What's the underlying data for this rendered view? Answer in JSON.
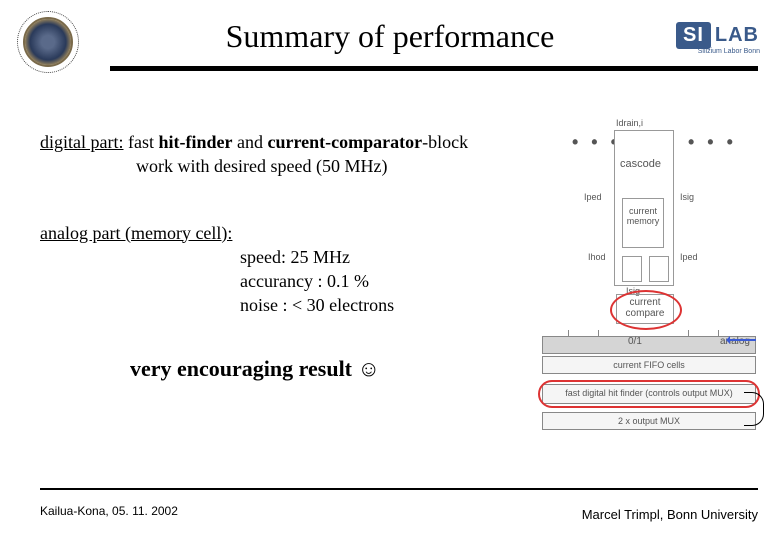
{
  "header": {
    "title": "Summary of performance",
    "logo_right_si": "SI",
    "logo_right_lab": "LAB",
    "logo_right_sub": "Silizium Labor Bonn"
  },
  "digital": {
    "label": "digital part:",
    "line1_a": "  fast ",
    "line1_b": "hit-finder",
    "line1_c": " and ",
    "line1_d": "current-comparator",
    "line1_e": "-block",
    "line2": "work with desired speed (50 MHz)"
  },
  "analog": {
    "label": "analog part (memory cell):",
    "spec1": "speed: 25 MHz",
    "spec2": "accurancy : 0.1 %",
    "spec3": "noise : < 30 electrons"
  },
  "encourage": {
    "text": "very encouraging result ",
    "emoji": "☺"
  },
  "diagram": {
    "idrain": "Idrain,i",
    "cascode": "cascode",
    "iped": "Iped",
    "isig": "Isig",
    "ihod": "Ihod",
    "current_memory": "current memory",
    "current_compare": "current compare",
    "row01": "0/1",
    "row_analog": "analog",
    "row_fifo": "current FIFO cells",
    "row_hit": "fast digital hit finder  (controls output MUX)",
    "row_mux": "2 x output MUX",
    "dots": "• • •"
  },
  "footer": {
    "left": "Kailua-Kona, 05. 11. 2002",
    "right": "Marcel Trimpl, Bonn University"
  }
}
